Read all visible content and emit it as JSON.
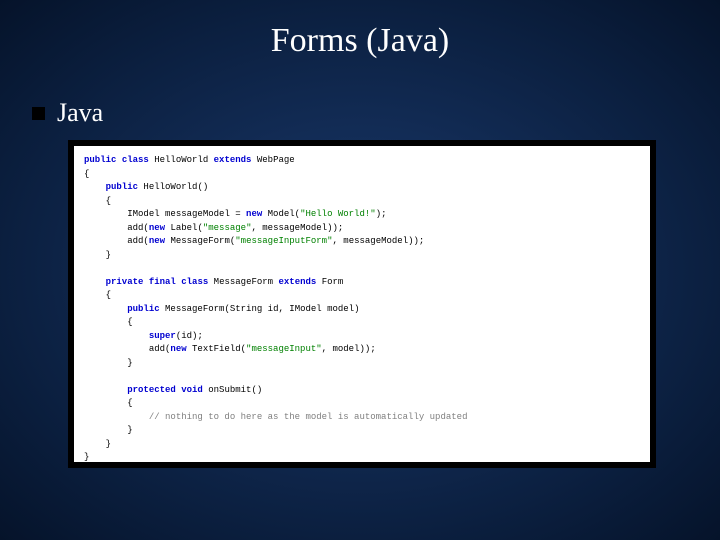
{
  "title": "Forms (Java)",
  "bullet": "Java",
  "code": {
    "kw_public": "public",
    "kw_class": "class",
    "kw_extends": "extends",
    "kw_new": "new",
    "kw_private": "private",
    "kw_final": "final",
    "kw_super": "super",
    "kw_protected": "protected",
    "kw_void": "void",
    "cls_HelloWorld": "HelloWorld",
    "cls_WebPage": "WebPage",
    "cls_IModel": "IModel",
    "cls_Model": "Model",
    "cls_Label": "Label",
    "cls_MessageForm": "MessageForm",
    "cls_Form": "Form",
    "cls_String": "String",
    "cls_TextField": "TextField",
    "id_messageModel": "messageModel",
    "id_id": "id",
    "id_model": "model",
    "id_add": "add",
    "id_onSubmit": "onSubmit",
    "str_helloWorld": "\"Hello World!\"",
    "str_message": "\"message\"",
    "str_messageInputForm": "\"messageInputForm\"",
    "str_messageInput": "\"messageInput\"",
    "cmt_nothing": "// nothing to do here as the model is automatically updated",
    "brace_open": "{",
    "brace_close": "}",
    "paren_openclose": "()",
    "semi": ";",
    "eq": " = "
  }
}
